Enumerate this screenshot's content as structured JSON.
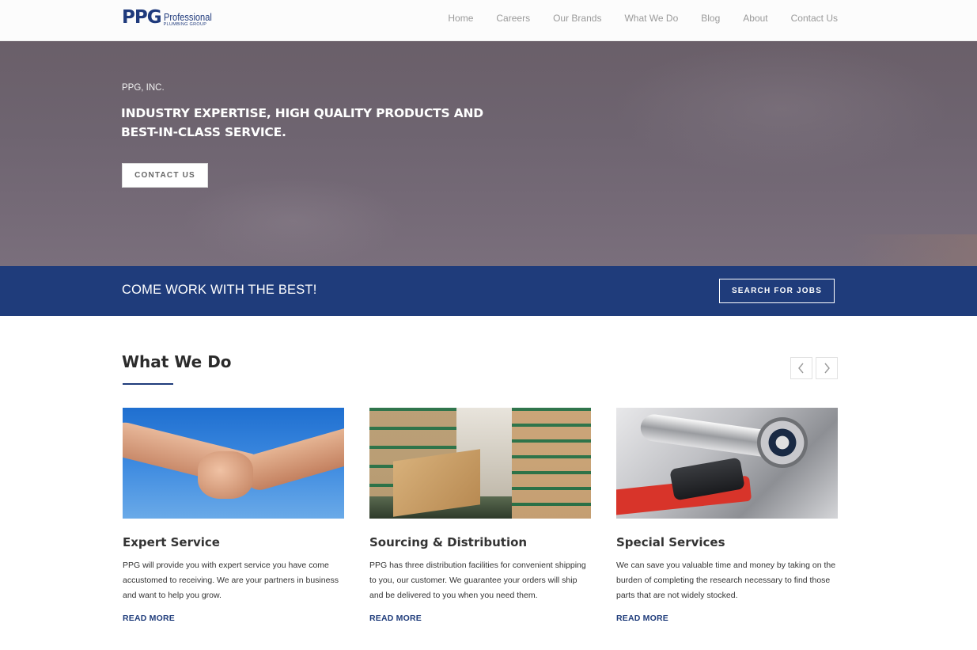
{
  "brand": {
    "logo_main": "PPG",
    "logo_top": "Professional",
    "logo_bottom": "PLUMBING GROUP"
  },
  "nav": {
    "items": [
      "Home",
      "Careers",
      "Our Brands",
      "What We Do",
      "Blog",
      "About",
      "Contact Us"
    ]
  },
  "hero": {
    "eyebrow": "PPG, INC.",
    "title": "INDUSTRY EXPERTISE, HIGH QUALITY PRODUCTS AND BEST-IN-CLASS SERVICE.",
    "button_label": "CONTACT US"
  },
  "band": {
    "text": "COME WORK WITH THE BEST!",
    "button_label": "SEARCH FOR JOBS"
  },
  "what_we_do": {
    "title": "What We Do",
    "prev_icon": "chevron-left-icon",
    "next_icon": "chevron-right-icon",
    "cards": [
      {
        "image": "handshake",
        "title": "Expert Service",
        "text": "PPG will provide you with expert service you have come accustomed to receiving. We are your partners in business and want to help you grow.",
        "link": "READ MORE"
      },
      {
        "image": "warehouse",
        "title": "Sourcing & Distribution",
        "text": "PPG has three distribution facilities for convenient shipping to you, our customer. We guarantee your orders will ship and be delivered to you when you need them.",
        "link": "READ MORE"
      },
      {
        "image": "faucet-and-wrench",
        "title": "Special Services",
        "text": "We can save you valuable time and money by taking on the burden of completing the research necessary to find those parts that are not widely stocked.",
        "link": "READ MORE"
      }
    ]
  },
  "colors": {
    "brand_blue": "#1f3c7b",
    "nav_text": "#9a9a9a"
  }
}
